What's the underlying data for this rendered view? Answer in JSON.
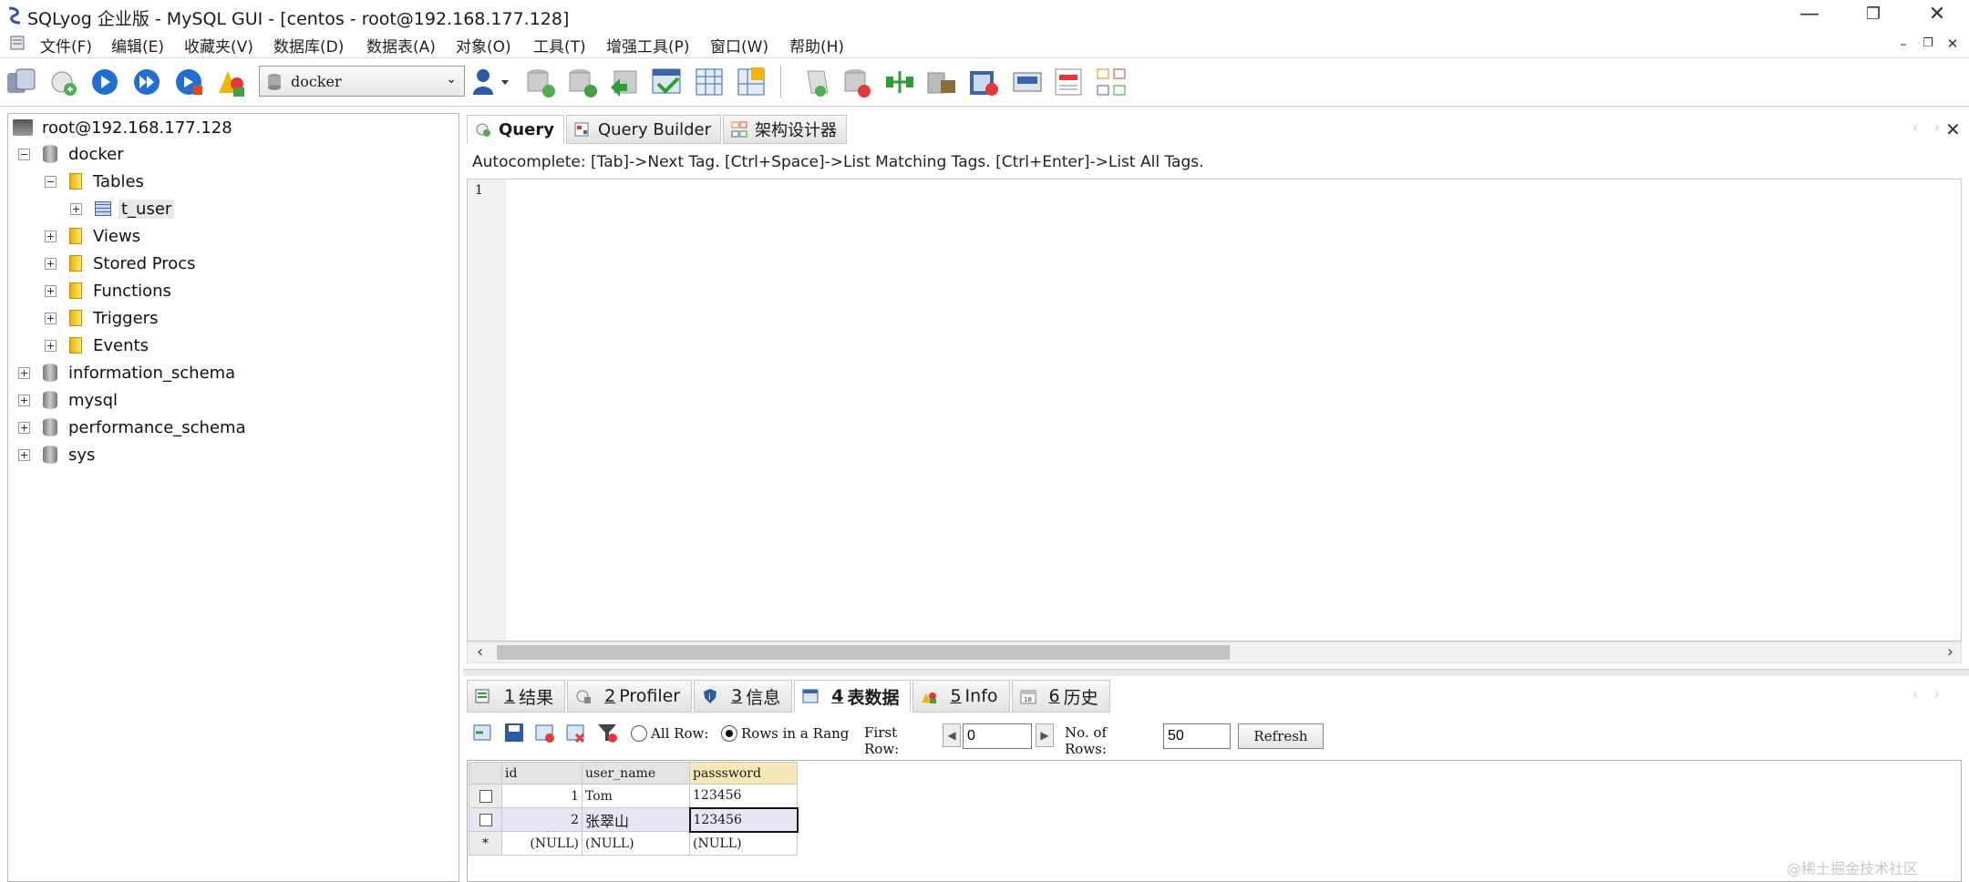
{
  "window": {
    "title": "SQLyog 企业版 - MySQL GUI - [centos - root@192.168.177.128]",
    "minimize": "—",
    "restore": "❐",
    "close": "✕"
  },
  "menu": {
    "items": [
      "文件(F)",
      "编辑(E)",
      "收藏夹(V)",
      "数据库(D)",
      "数据表(A)",
      "对象(O)",
      "工具(T)",
      "增强工具(P)",
      "窗口(W)",
      "帮助(H)"
    ],
    "mdi_minimize": "–",
    "mdi_restore": "❐",
    "mdi_close": "✕"
  },
  "toolbar": {
    "database_select": "docker"
  },
  "tree": {
    "server": "root@192.168.177.128",
    "databases": [
      {
        "name": "docker"
      },
      {
        "name": "information_schema"
      },
      {
        "name": "mysql"
      },
      {
        "name": "performance_schema"
      },
      {
        "name": "sys"
      }
    ],
    "folders": [
      "Tables",
      "Views",
      "Stored Procs",
      "Functions",
      "Triggers",
      "Events"
    ],
    "table": "t_user"
  },
  "editor": {
    "tabs": [
      "Query",
      "Query Builder",
      "架构设计器"
    ],
    "autocomplete_hint": "Autocomplete: [Tab]->Next Tag. [Ctrl+Space]->List Matching Tags. [Ctrl+Enter]->List All Tags.",
    "line_number": "1",
    "close": "✕",
    "nav": "‹ ›",
    "scroll_left": "‹",
    "scroll_right": "›"
  },
  "results": {
    "tabs": [
      {
        "num": "1",
        "label": "结果"
      },
      {
        "num": "2",
        "label": "Profiler"
      },
      {
        "num": "3",
        "label": "信息"
      },
      {
        "num": "4",
        "label": "表数据"
      },
      {
        "num": "5",
        "label": "Info"
      },
      {
        "num": "6",
        "label": "历史"
      }
    ],
    "nav": "‹ ›",
    "all_rows_label": "All Row:",
    "range_label": "Rows in a Rang",
    "first_row_label_1": "First",
    "first_row_label_2": "Row:",
    "first_row_value": "0",
    "num_rows_label_1": "No. of",
    "num_rows_label_2": "Rows:",
    "num_rows_value": "50",
    "refresh": "Refresh",
    "spin_prev": "◀",
    "spin_next": "▶"
  },
  "grid": {
    "columns": [
      "id",
      "user_name",
      "passsword"
    ],
    "rows": [
      {
        "id": "1",
        "user_name": "Tom",
        "password": "123456"
      },
      {
        "id": "2",
        "user_name": "张翠山",
        "password": "123456"
      },
      {
        "id": "(NULL)",
        "user_name": "(NULL)",
        "password": "(NULL)",
        "marker": "*"
      }
    ]
  },
  "watermark": "@稀土掘金技术社区"
}
